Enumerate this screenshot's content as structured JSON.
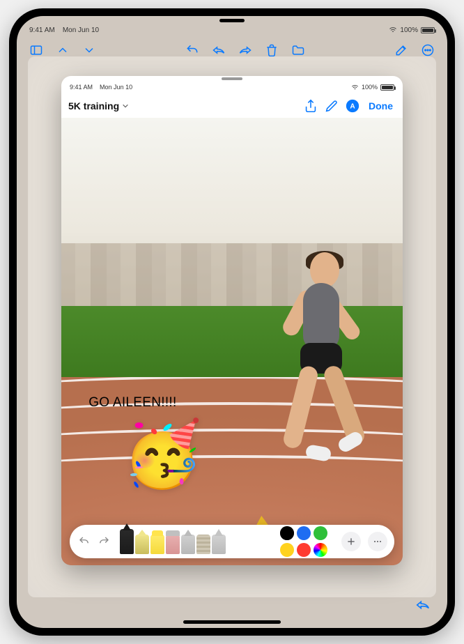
{
  "statusbar": {
    "time": "9:41 AM",
    "date": "Mon Jun 10",
    "battery": "100%"
  },
  "bg_app": {
    "reply_icon": "reply"
  },
  "sheet": {
    "statusbar": {
      "time": "9:41 AM",
      "date": "Mon Jun 10",
      "battery": "100%"
    },
    "title": "5K training",
    "done": "Done"
  },
  "annotation": {
    "text": "GO AILEEN!!!!",
    "emoji": "🥳"
  },
  "markup": {
    "tools": [
      "pen",
      "marker",
      "highlighter",
      "eraser",
      "lasso",
      "ruler",
      "pencil"
    ],
    "active_tool": "pen",
    "colors": {
      "black": "#000000",
      "blue": "#1f6df2",
      "green": "#2fbf3a",
      "yellow": "#ffd21f",
      "red": "#ff3b30"
    },
    "selected_color": "black"
  }
}
